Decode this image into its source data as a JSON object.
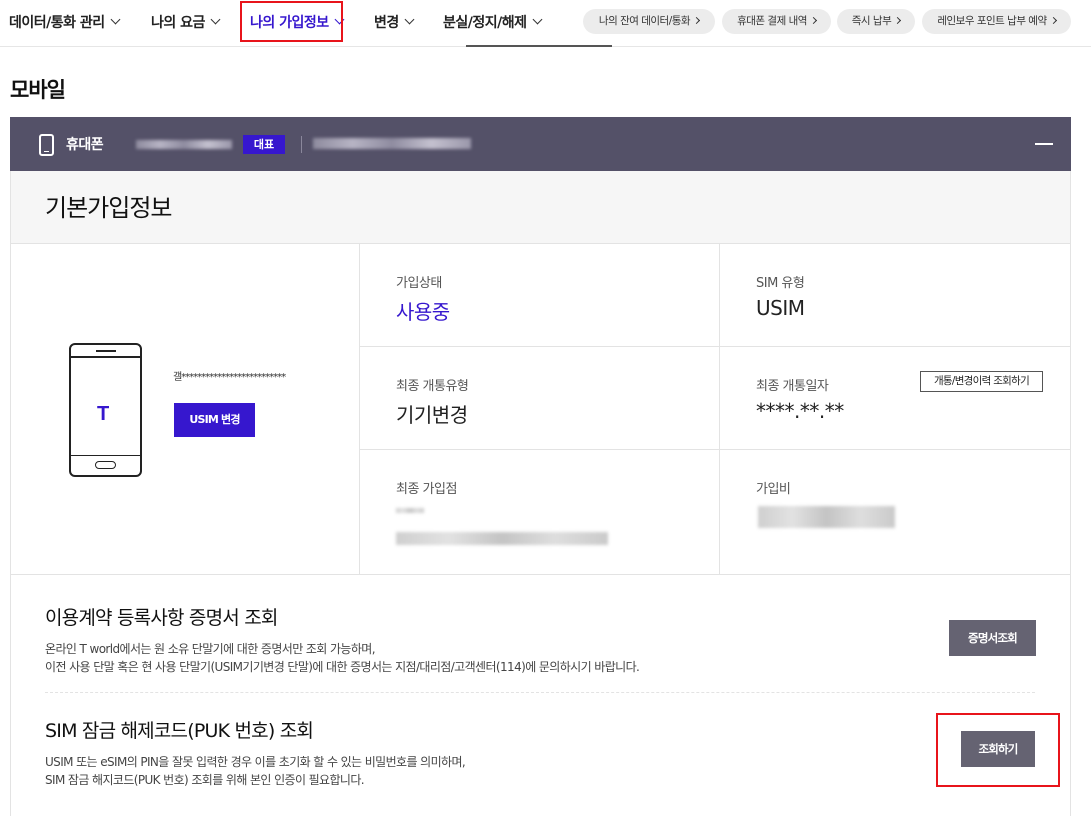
{
  "nav": {
    "items": [
      {
        "label": "데이터/통화 관리"
      },
      {
        "label": "나의 요금"
      },
      {
        "label": "나의 가입정보"
      },
      {
        "label": "변경"
      },
      {
        "label": "분실/정지/해제"
      }
    ],
    "shortcuts": [
      {
        "label": "나의 잔여 데이터/통화"
      },
      {
        "label": "휴대폰 결제 내역"
      },
      {
        "label": "즉시 납부"
      },
      {
        "label": "레인보우 포인트 납부 예약"
      }
    ]
  },
  "page": {
    "title": "모바일"
  },
  "line": {
    "type_label": "휴대폰",
    "badge": "대표"
  },
  "card": {
    "title": "기본가입정보",
    "device": {
      "model": "갤**************************",
      "usim_button": "USIM 변경",
      "logo": "T"
    },
    "status": {
      "label": "가입상태",
      "value": "사용중"
    },
    "sim_type": {
      "label": "SIM 유형",
      "value": "USIM"
    },
    "last_open_type": {
      "label": "최종 개통유형",
      "value": "기기변경"
    },
    "last_open_date": {
      "label": "최종 개통일자",
      "value": "****.**.**",
      "history_button": "개통/변경이력 조회하기"
    },
    "last_store": {
      "label": "최종 가입점"
    },
    "join_fee": {
      "label": "가입비"
    }
  },
  "contract": {
    "title": "이용계약 등록사항 증명서 조회",
    "desc_line1": "온라인 T world에서는 원 소유 단말기에 대한 증명서만 조회 가능하며,",
    "desc_line2": "이전 사용 단말 혹은 현 사용 단말기(USIM기기변경 단말)에 대한 증명서는 지점/대리점/고객센터(114)에 문의하시기 바랍니다.",
    "button": "증명서조회"
  },
  "puk": {
    "title": "SIM 잠금 해제코드(PUK 번호) 조회",
    "desc_line1": "USIM 또는 eSIM의 PIN을 잘못 입력한 경우 이를 초기화 할 수 있는 비밀번호를 의미하며,",
    "desc_line2": "SIM 잠금 해지코드(PUK 번호) 조회를 위해 본인 인증이 필요합니다.",
    "button": "조회하기"
  },
  "colors": {
    "accent": "#3617ce",
    "bar": "#545168",
    "highlight": "#e8141b"
  }
}
